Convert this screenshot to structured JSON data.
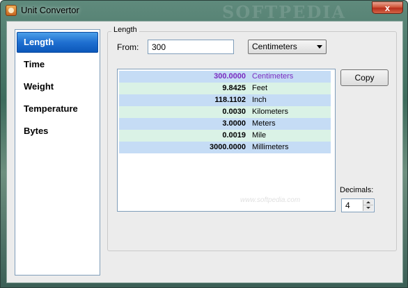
{
  "window": {
    "title": "Unit Convertor",
    "close_glyph": "x",
    "watermark": "SOFTPEDIA"
  },
  "sidebar": {
    "items": [
      {
        "label": "Length",
        "selected": true
      },
      {
        "label": "Time"
      },
      {
        "label": "Weight"
      },
      {
        "label": "Temperature"
      },
      {
        "label": "Bytes"
      }
    ]
  },
  "panel": {
    "group_title": "Length",
    "from_label": "From:",
    "from_value": "300",
    "from_unit": "Centimeters",
    "copy_label": "Copy",
    "decimals_label": "Decimals:",
    "decimals_value": "4",
    "softpedia": "www.softpedia.com"
  },
  "results": [
    {
      "value": "300.0000",
      "unit": "Centimeters"
    },
    {
      "value": "9.8425",
      "unit": "Feet"
    },
    {
      "value": "118.1102",
      "unit": "Inch"
    },
    {
      "value": "0.0030",
      "unit": "Kilometers"
    },
    {
      "value": "3.0000",
      "unit": "Meters"
    },
    {
      "value": "0.0019",
      "unit": "Mile"
    },
    {
      "value": "3000.0000",
      "unit": "Millimeters"
    }
  ],
  "colors": {
    "selected_bg": "#1f6fd0",
    "row_blue": "#c5dcf5",
    "row_green": "#daf2e6",
    "active_text": "#7a2ac0"
  },
  "icons": {
    "app": "ruler-app-icon",
    "close": "close-icon",
    "dropdown": "chevron-down-icon"
  }
}
